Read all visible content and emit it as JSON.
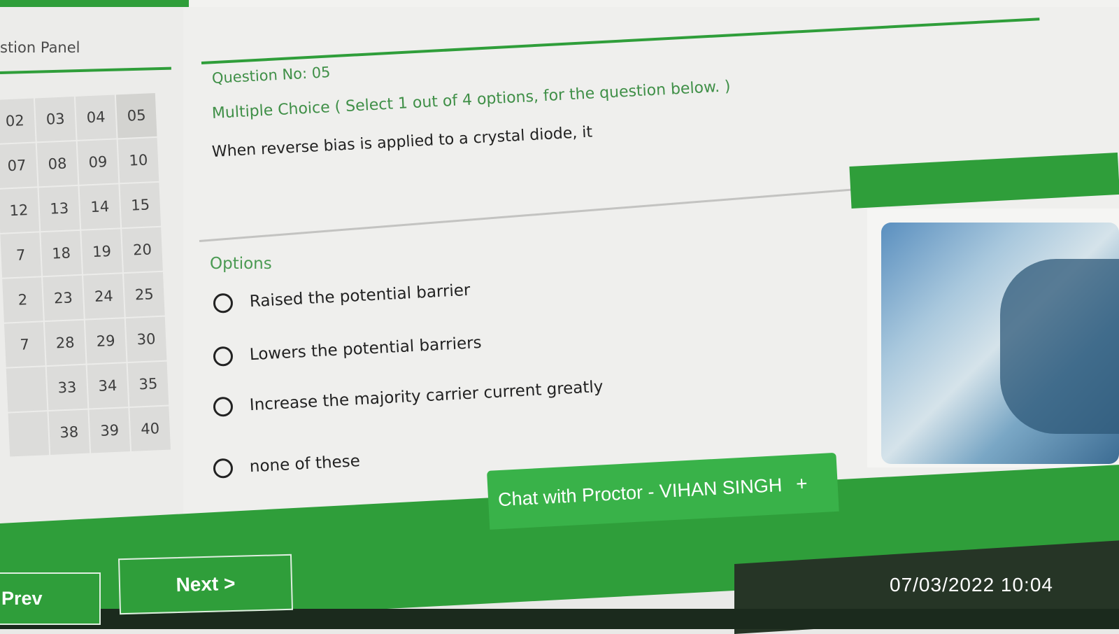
{
  "panel": {
    "title": "stion Panel",
    "questions": [
      "02",
      "03",
      "04",
      "05",
      "07",
      "08",
      "09",
      "10",
      "12",
      "13",
      "14",
      "15",
      "7",
      "18",
      "19",
      "20",
      "2",
      "23",
      "24",
      "25",
      "7",
      "28",
      "29",
      "30",
      "",
      "33",
      "34",
      "35",
      "",
      "38",
      "39",
      "40"
    ],
    "current": "05"
  },
  "question": {
    "number_label": "Question No: 05",
    "type_label": "Multiple Choice ( Select 1 out of 4 options, for the question below. )",
    "text": "When reverse bias is applied to a crystal diode, it"
  },
  "options": {
    "heading": "Options",
    "items": [
      "Raised the potential barrier",
      "Lowers the potential barriers",
      "Increase the majority carrier current greatly",
      "none of these"
    ]
  },
  "chat": {
    "label": "Chat with Proctor - VIHAN SINGH",
    "plus_icon": "+"
  },
  "nav": {
    "prev_label": "Prev",
    "next_label": "Next >"
  },
  "overlay": {
    "timestamp": "07/03/2022 10:04"
  },
  "colors": {
    "accent": "#2f9e3a",
    "text_green": "#3f8f47"
  }
}
